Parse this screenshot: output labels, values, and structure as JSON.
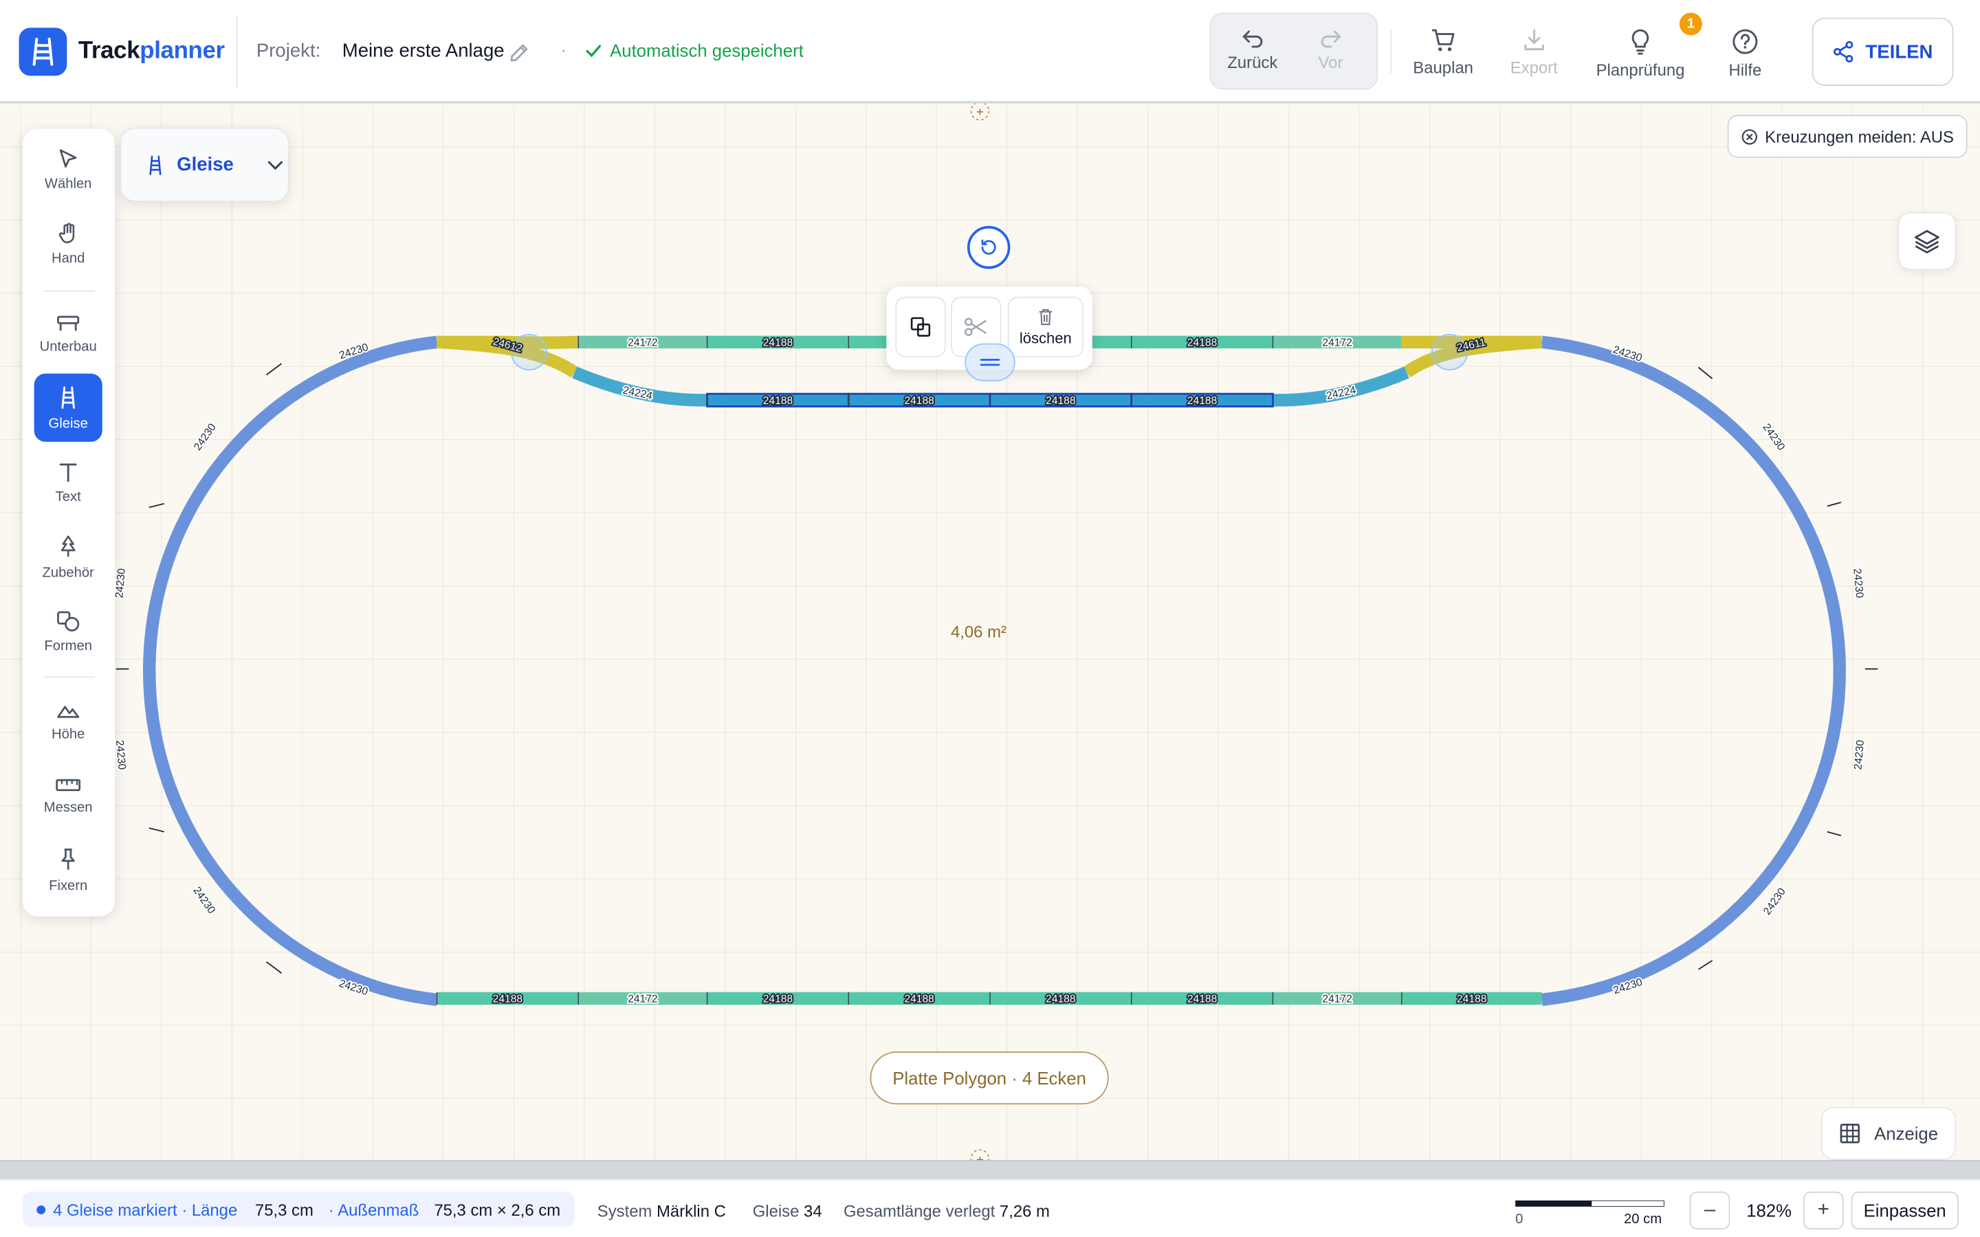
{
  "app": {
    "name_prefix": "Track",
    "name_accent": "planner"
  },
  "project": {
    "label": "Projekt:",
    "name": "Meine erste Anlage",
    "save_status": "Automatisch gespeichert"
  },
  "header": {
    "undo_label": "Zurück",
    "redo_label": "Vor",
    "bauplan_label": "Bauplan",
    "export_label": "Export",
    "planpruefung_label": "Planprüfung",
    "planpruefung_badge": "1",
    "hilfe_label": "Hilfe",
    "share_label": "TEILEN"
  },
  "toolbar": {
    "items": [
      {
        "label": "Wählen",
        "icon": "cursor-icon"
      },
      {
        "label": "Hand",
        "icon": "hand-icon"
      },
      {
        "label": "Unterbau",
        "icon": "bench-icon"
      },
      {
        "label": "Gleise",
        "icon": "track-icon",
        "active": true
      },
      {
        "label": "Text",
        "icon": "text-icon"
      },
      {
        "label": "Zubehör",
        "icon": "tree-icon"
      },
      {
        "label": "Formen",
        "icon": "shapes-icon"
      },
      {
        "label": "Höhe",
        "icon": "mountain-icon"
      },
      {
        "label": "Messen",
        "icon": "ruler-icon"
      },
      {
        "label": "Fixern",
        "icon": "pin-icon"
      }
    ]
  },
  "track_dropdown": {
    "label": "Gleise"
  },
  "crossing_toggle": {
    "label": "Kreuzungen meiden: AUS"
  },
  "context_menu": {
    "delete_label": "löschen"
  },
  "canvas": {
    "area_label": "4,06 m²",
    "plate_label": "Platte Polygon · 4 Ecken",
    "display_label": "Anzeige",
    "track_numbers": {
      "curve": "24230",
      "straight": "24188",
      "short": "24172",
      "curve_branch": "24224",
      "switch_left": "24612",
      "switch_right": "24611"
    },
    "colors": {
      "curve": "#6b93db",
      "straight": "#54c8a7",
      "short": "#6cc8aa",
      "switch": "#d4c232",
      "selected": "#2d9bd1",
      "branch": "#45a9cf"
    }
  },
  "statusbar": {
    "selection_text": "4 Gleise markiert · Länge",
    "length_value": "75,3 cm",
    "outer_label": "· Außenmaß",
    "outer_value": "75,3 cm × 2,6 cm",
    "system_label": "System",
    "system_value": "Märklin C",
    "tracks_label": "Gleise",
    "tracks_value": "34",
    "total_label": "Gesamtlänge verlegt",
    "total_value": "7,26 m",
    "scale_start": "0",
    "scale_end": "20 cm",
    "zoom_out": "–",
    "zoom_value": "182%",
    "zoom_in": "+",
    "fit_label": "Einpassen"
  }
}
